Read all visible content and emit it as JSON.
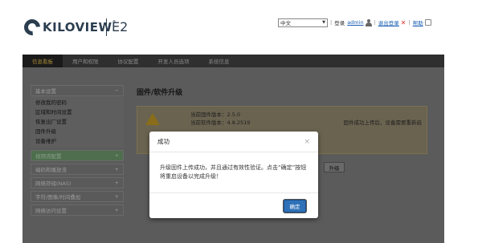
{
  "header": {
    "brand": "KILOVIEW",
    "brand_mark": "®",
    "model": "E2",
    "language": "中文",
    "login_label": "登录",
    "username": "admin",
    "logout_label": "退出登录",
    "help_label": "帮助",
    "separator": "|"
  },
  "nav": {
    "items": [
      {
        "label": "信息看板"
      },
      {
        "label": "用户和权限"
      },
      {
        "label": "协议配置"
      },
      {
        "label": "开发人员选项"
      },
      {
        "label": "系统信息"
      }
    ]
  },
  "sidebar": {
    "basic_title": "基本设置",
    "basic_toggle": "−",
    "basic_items": [
      {
        "label": "修改我的密码"
      },
      {
        "label": "区域和时间设置"
      },
      {
        "label": "恢复出厂设置"
      },
      {
        "label": "固件升级"
      },
      {
        "label": "设备维护"
      }
    ],
    "groups": [
      {
        "label": "视频流配置",
        "toggle": "+"
      },
      {
        "label": "编码和播放流",
        "toggle": "+"
      },
      {
        "label": "网络存储(NAS)",
        "toggle": "+"
      },
      {
        "label": "字符/图像/时间叠加",
        "toggle": "+"
      },
      {
        "label": "网络访问设置",
        "toggle": "+"
      }
    ]
  },
  "content": {
    "title": "固件/软件升级",
    "current_firmware": "当前固件版本：2.5.0",
    "current_software": "当前软件版本：4.8.2519",
    "notice_tail": "固件成功上传后，设备需要",
    "reboot_link": "重新启",
    "upgrade_button": "升级"
  },
  "modal": {
    "title": "成功",
    "close": "×",
    "message": "升级固件上传成功，并且通过有效性验证。点击“确定”按钮将重启设备以完成升级！",
    "ok_button": "确定"
  },
  "colors": {
    "primary": "#2f71b8",
    "brand": "#2b3e50",
    "logout": "#d9342b",
    "nav_active": "#a88a3a"
  }
}
